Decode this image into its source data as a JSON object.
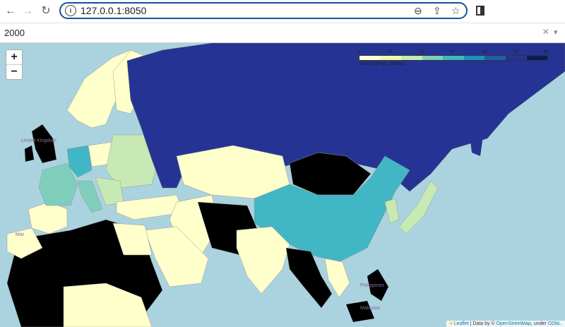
{
  "browser": {
    "url": "127.0.0.1:8050",
    "icons": [
      "back-arrow-icon",
      "forward-arrow-icon",
      "reload-icon",
      "info-icon",
      "zoom-out-icon",
      "share-icon",
      "bookmark-star-icon",
      "side-panel-icon"
    ]
  },
  "dropdown": {
    "value": "2000",
    "clear": "×",
    "arrow": "▾"
  },
  "map": {
    "zoom_in": "+",
    "zoom_out": "−",
    "legend": {
      "ticks": [
        "1",
        "16",
        "32",
        "47",
        "62",
        "78",
        "93"
      ],
      "caption": "Total Olympic Medals",
      "colors": [
        "#ffffd9",
        "#edf8b1",
        "#c7e9b4",
        "#7fcdbb",
        "#41b6c4",
        "#1d91c0",
        "#225ea8",
        "#253494",
        "#081d58"
      ]
    },
    "place_labels": [
      {
        "text": "United Kingdom"
      },
      {
        "text": "Philippines"
      },
      {
        "text": "Malaysia"
      },
      {
        "text": "Mar"
      }
    ],
    "attribution": {
      "leaflet": "Leaflet",
      "middle": "| Data by ©",
      "osm": "OpenStreetMap",
      "under": ", under",
      "odbl": "ODbL."
    },
    "colors": {
      "ocean": "#aad3df",
      "nodata": "#000000",
      "low": "#ffffcc",
      "pale_green": "#c7e9b4",
      "teal": "#41b6c4",
      "russia": "#253494",
      "germany": "#41b6c4",
      "france": "#7fcdbb"
    }
  }
}
